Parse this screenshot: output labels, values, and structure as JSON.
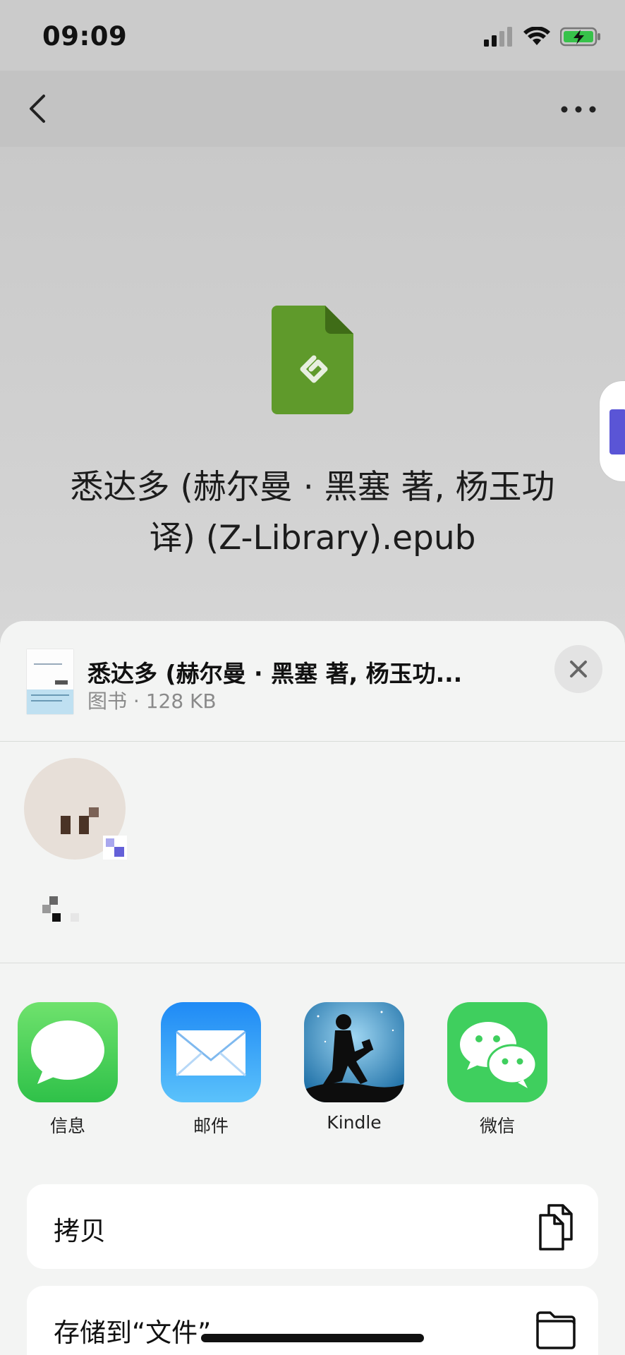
{
  "status_bar": {
    "time": "09:09"
  },
  "preview": {
    "file_name": "悉达多 (赫尔曼 · 黑塞 著, 杨玉功 译) (Z-Library).epub"
  },
  "share_sheet": {
    "file_title": "悉达多 (赫尔曼 · 黑塞 著, 杨玉功...",
    "file_meta": "图书 · 128 KB",
    "apps": [
      {
        "label": "信息",
        "icon": "messages-icon"
      },
      {
        "label": "邮件",
        "icon": "mail-icon"
      },
      {
        "label": "Kindle",
        "icon": "kindle-icon"
      },
      {
        "label": "微信",
        "icon": "wechat-icon"
      }
    ],
    "actions": [
      {
        "label": "拷贝",
        "icon": "copy-icon"
      },
      {
        "label": "存储到“文件”",
        "icon": "folder-icon"
      }
    ]
  },
  "colors": {
    "epub_green": "#5f9a2b",
    "messages_green": "#4cd964",
    "mail_blue": "#2d8cf7",
    "wechat_green": "#3fcf5e"
  }
}
